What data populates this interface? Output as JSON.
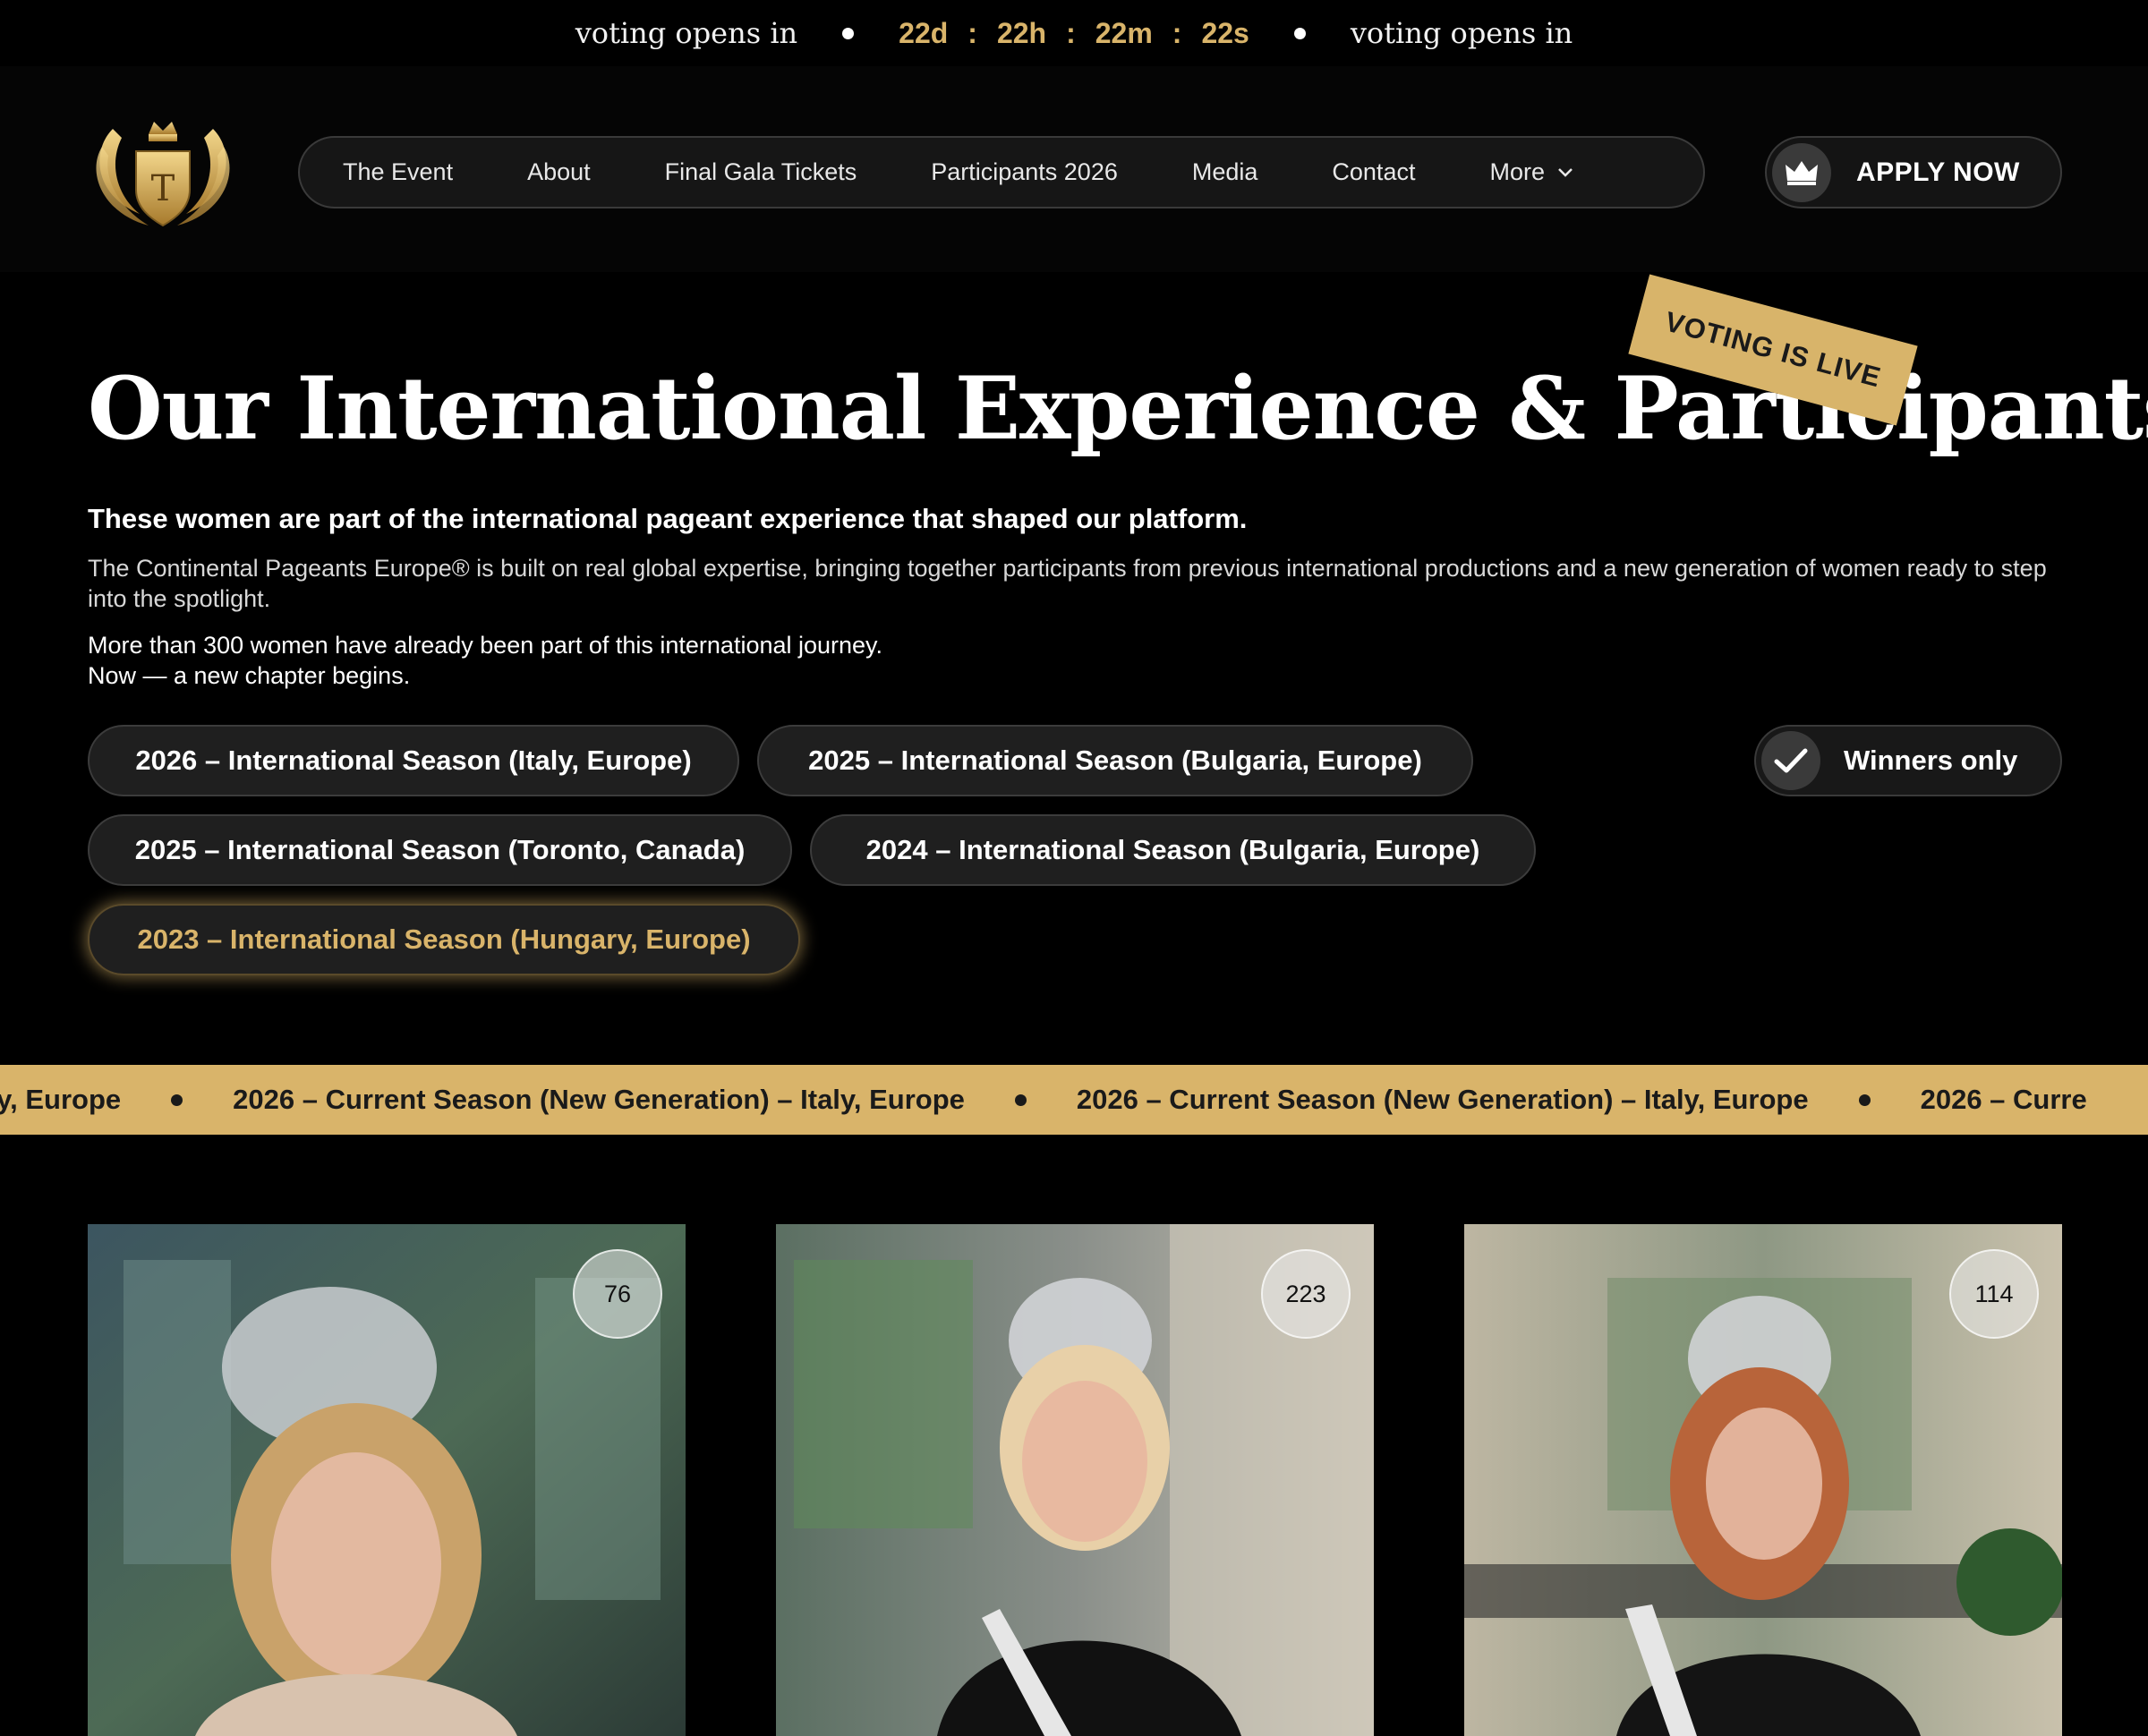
{
  "countdown": {
    "label_left": "voting opens in",
    "days": "22d",
    "hours": "22h",
    "minutes": "22m",
    "seconds": "22s",
    "separator": ":",
    "label_right": "voting opens in"
  },
  "header": {
    "logo_letter": "T",
    "nav": [
      {
        "label": "The Event"
      },
      {
        "label": "About"
      },
      {
        "label": "Final Gala Tickets"
      },
      {
        "label": "Participants 2026"
      },
      {
        "label": "Media"
      },
      {
        "label": "Contact"
      },
      {
        "label": "More"
      }
    ],
    "apply_label": "APPLY NOW"
  },
  "hero": {
    "title": "Our International Experience & Participants",
    "badge": "VOTING IS LIVE",
    "lead": "These women are part of the international pageant experience that shaped our platform.",
    "paragraph": "The Continental Pageants Europe® is built on real global expertise, bringing together participants from previous international productions and a new generation of women ready to step into the spotlight.",
    "paragraph2_line1": "More than 300 women have already been part of this international journey.",
    "paragraph2_line2": "Now — a new chapter begins."
  },
  "filters": {
    "seasons": [
      {
        "label": "2026 – International Season (Italy, Europe)"
      },
      {
        "label": "2025 – International Season  (Bulgaria, Europe)"
      },
      {
        "label": "2025 – International Season (Toronto, Canada)"
      },
      {
        "label": "2024 – International Season  (Bulgaria, Europe)"
      },
      {
        "label": "2023 – International Season (Hungary, Europe)"
      }
    ],
    "active_index": 4,
    "winners_label": "Winners only",
    "winners_checked": true
  },
  "ticker": {
    "partial_start": "taly, Europe",
    "item": "2026 – Current Season (New Generation) – Italy, Europe",
    "partial_end": "2026 – Curre"
  },
  "cards": [
    {
      "count": "76"
    },
    {
      "count": "223"
    },
    {
      "count": "114"
    }
  ],
  "colors": {
    "accent_gold": "#d9b46a",
    "background": "#000000",
    "chip_bg": "#1f1f1f"
  }
}
